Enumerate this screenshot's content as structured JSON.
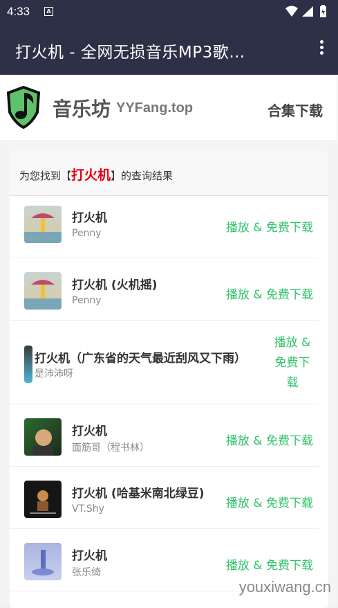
{
  "status_bar": {
    "time": "4:33"
  },
  "app_bar": {
    "title": "打火机 - 全网无损音乐MP3歌…"
  },
  "site": {
    "name": "音乐坊",
    "domain": "YYFang.top",
    "collection_link": "合集下载"
  },
  "results": {
    "prefix": "为您找到【",
    "keyword": "打火机",
    "suffix": "】的查询结果"
  },
  "songs": [
    {
      "title": "打火机",
      "artist": "Penny",
      "action": "播放 & 免费下载"
    },
    {
      "title": "打火机 (火机摇)",
      "artist": "Penny",
      "action": "播放 & 免费下载"
    },
    {
      "title": "打火机（广东省的天气最近刮风又下雨）",
      "artist": "是沛沛呀",
      "action": "播放 & 免费下载"
    },
    {
      "title": "打火机",
      "artist": "面筋哥（程书林）",
      "action": "播放 & 免费下载"
    },
    {
      "title": "打火机 (哈基米南北绿豆)",
      "artist": "VT.Shy",
      "action": "播放 & 免费下载"
    },
    {
      "title": "打火机",
      "artist": "张乐绮",
      "action": "播放 & 免费下载"
    }
  ],
  "watermark": "youxiwang.cn",
  "colors": {
    "app_bar": "#2d3047",
    "keyword": "#e60012",
    "action": "#2ec36a"
  }
}
